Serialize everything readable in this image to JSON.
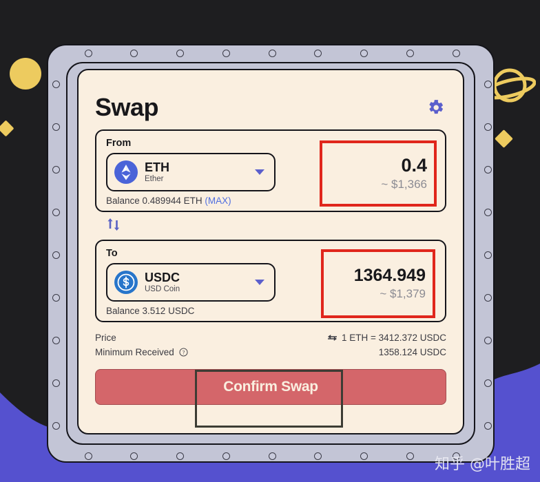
{
  "app": {
    "title": "Swap",
    "settings_icon": "gear-icon",
    "watermark": "知乎 @叶胜超"
  },
  "from": {
    "label": "From",
    "token_symbol": "ETH",
    "token_name": "Ether",
    "token_icon": "ethereum-icon",
    "amount": "0.4",
    "amount_usd": "~ $1,366",
    "balance_text": "Balance 0.489944 ETH",
    "max_label": "(MAX)",
    "highlight_color": "#e0261c"
  },
  "swap_toggle": {
    "icon": "swap-vertical-arrows-icon"
  },
  "to": {
    "label": "To",
    "token_symbol": "USDC",
    "token_name": "USD Coin",
    "token_icon": "usdc-icon",
    "amount": "1364.949",
    "amount_usd": "~ $1,379",
    "balance_text": "Balance 3.512 USDC",
    "highlight_color": "#e0261c"
  },
  "details": {
    "price_label": "Price",
    "price_icon": "swap-horizontal-icon",
    "price_value": "1 ETH = 3412.372 USDC",
    "minimum_label": "Minimum Received",
    "minimum_info_icon": "question-circle-icon",
    "minimum_value": "1358.124 USDC"
  },
  "confirm": {
    "label": "Confirm Swap",
    "color": "#d4666a"
  },
  "theme": {
    "background": "#1e1e20",
    "wave": "#5551cf",
    "frame": "#c3c5d6",
    "card": "#faefe0",
    "accent": "#5b5fcc",
    "decor_yellow": "#edcb5f"
  },
  "decor": {
    "circle": "yellow-circle-shape",
    "diamond_left": "yellow-diamond-shape",
    "diamond_right": "yellow-diamond-shape",
    "planet": "saturn-planet-icon"
  }
}
